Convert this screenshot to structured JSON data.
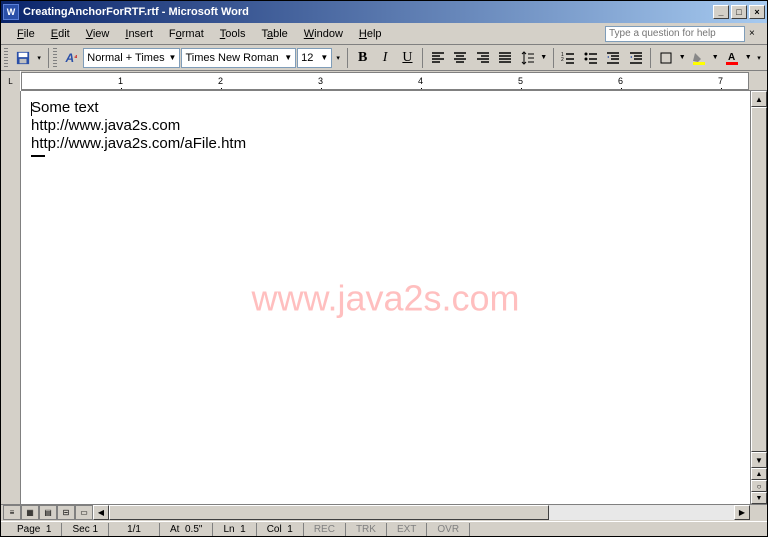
{
  "title": "CreatingAnchorForRTF.rtf - Microsoft Word",
  "menus": [
    "File",
    "Edit",
    "View",
    "Insert",
    "Format",
    "Tools",
    "Table",
    "Window",
    "Help"
  ],
  "help_placeholder": "Type a question for help",
  "toolbar": {
    "style": "Normal + Times",
    "font": "Times New Roman",
    "size": "12",
    "bold": "B",
    "italic": "I",
    "underline": "U",
    "read_label": "A"
  },
  "ruler_numbers": [
    "1",
    "2",
    "3",
    "4",
    "5",
    "6",
    "7"
  ],
  "document": {
    "lines": [
      "Some text",
      "http://www.java2s.com",
      "http://www.java2s.com/aFile.htm"
    ]
  },
  "watermark": "www.java2s.com",
  "status": {
    "page": "Page  1",
    "sec": "Sec 1",
    "pages": "1/1",
    "at": "At  0.5\"",
    "ln": "Ln  1",
    "col": "Col  1",
    "rec": "REC",
    "trk": "TRK",
    "ext": "EXT",
    "ovr": "OVR"
  }
}
